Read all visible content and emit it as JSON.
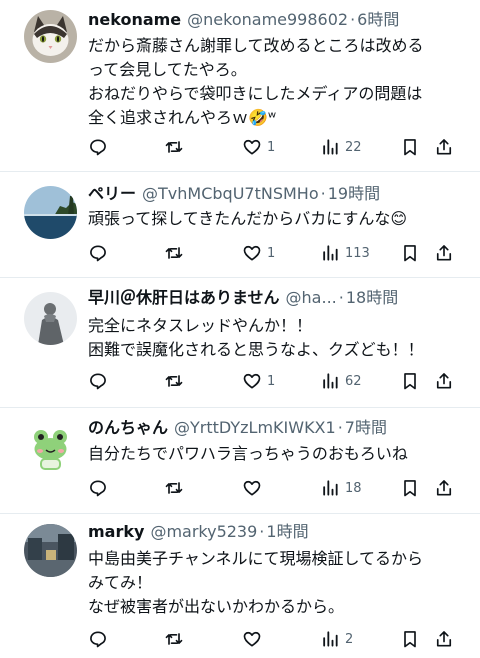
{
  "tweets": [
    {
      "display_name": "nekoname",
      "handle": "@nekoname998602",
      "time": "6時間",
      "lines": [
        "だから斎藤さん謝罪して改めるところは改める",
        "って会見してたやろ。",
        "おねだりやらで袋叩きにしたメディアの問題は",
        "全く追求されんやろｗ🤣ʷ"
      ],
      "reply_count": "",
      "retweet_count": "",
      "like_count": "1",
      "view_count": "22",
      "avatar_icon": "cat-avatar-icon"
    },
    {
      "display_name": "ペリー",
      "handle": "@TvhMCbqU7tNSMHo",
      "time": "19時間",
      "lines": [
        "頑張って探してきたんだからバカにすんな😊"
      ],
      "reply_count": "",
      "retweet_count": "",
      "like_count": "1",
      "view_count": "113",
      "avatar_icon": "seascape-avatar-icon"
    },
    {
      "display_name": "早川＠休肝日はありません",
      "handle": "@ha...",
      "time": "18時間",
      "lines": [
        "完全にネタスレッドやんか！！",
        "困難で誤魔化されると思うなよ、クズども！！"
      ],
      "reply_count": "",
      "retweet_count": "",
      "like_count": "1",
      "view_count": "62",
      "avatar_icon": "statue-avatar-icon"
    },
    {
      "display_name": "のんちゃん",
      "handle": "@YrttDYzLmKIWKX1",
      "time": "7時間",
      "lines": [
        "自分たちでパワハラ言っちゃうのおもろいね"
      ],
      "reply_count": "",
      "retweet_count": "",
      "like_count": "",
      "view_count": "18",
      "avatar_icon": "frog-avatar-icon"
    },
    {
      "display_name": "marky",
      "handle": "@marky5239",
      "time": "1時間",
      "lines": [
        "中島由美子チャンネルにて現場検証してるから",
        "みてみ！",
        "なぜ被害者が出ないかわかるから。"
      ],
      "reply_count": "",
      "retweet_count": "",
      "like_count": "",
      "view_count": "2",
      "avatar_icon": "street-avatar-icon"
    }
  ],
  "separator": "·",
  "colors": {
    "text": "#0f1419",
    "meta": "#536471",
    "divider": "#e6ecf0"
  }
}
